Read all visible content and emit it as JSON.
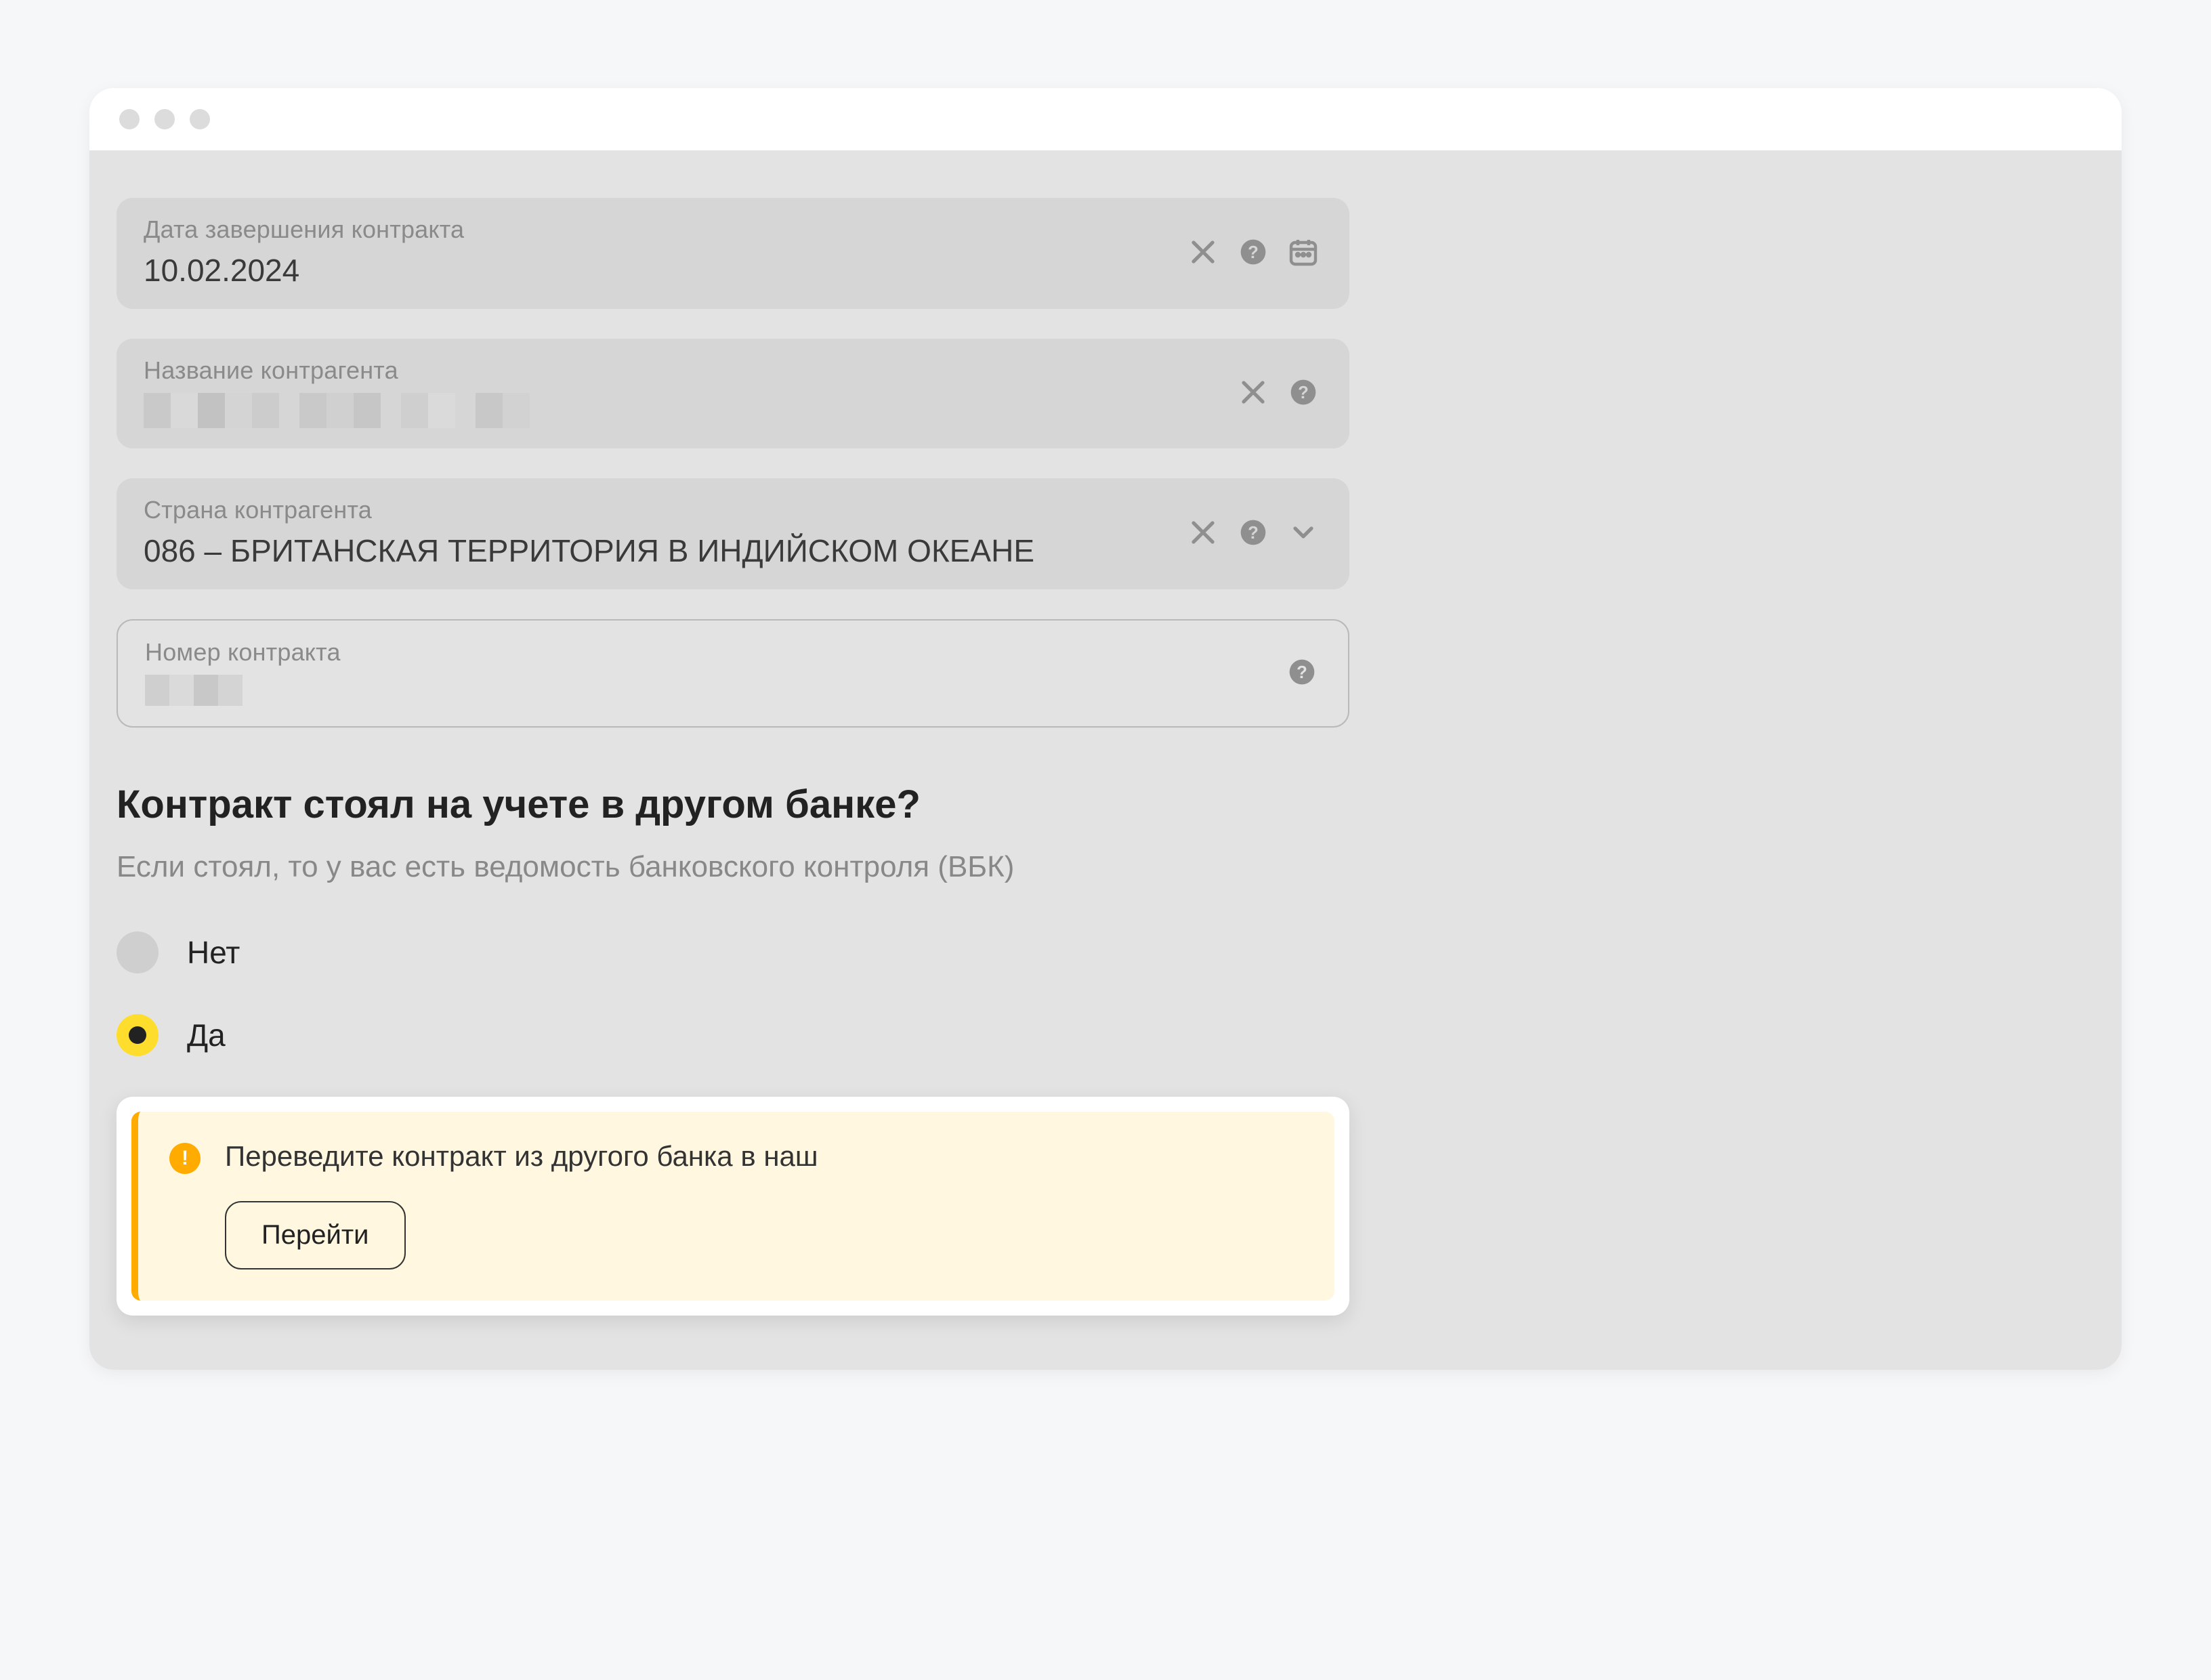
{
  "fields": {
    "contract_end": {
      "label": "Дата завершения контракта",
      "value": "10.02.2024"
    },
    "counterparty_name": {
      "label": "Название контрагента",
      "value": ""
    },
    "counterparty_country": {
      "label": "Страна контрагента",
      "value": "086 – БРИТАНСКАЯ ТЕРРИТОРИЯ В ИНДИЙСКОМ ОКЕАНЕ"
    },
    "contract_number": {
      "label": "Номер контракта",
      "value": ""
    }
  },
  "question": {
    "heading": "Контракт стоял на учете в другом банке?",
    "subtext": "Если стоял, то у вас есть ведомость банковского контроля (ВБК)",
    "options": {
      "no": "Нет",
      "yes": "Да"
    },
    "selected": "yes"
  },
  "alert": {
    "message": "Переведите контракт из другого банка в наш",
    "button": "Перейти"
  }
}
